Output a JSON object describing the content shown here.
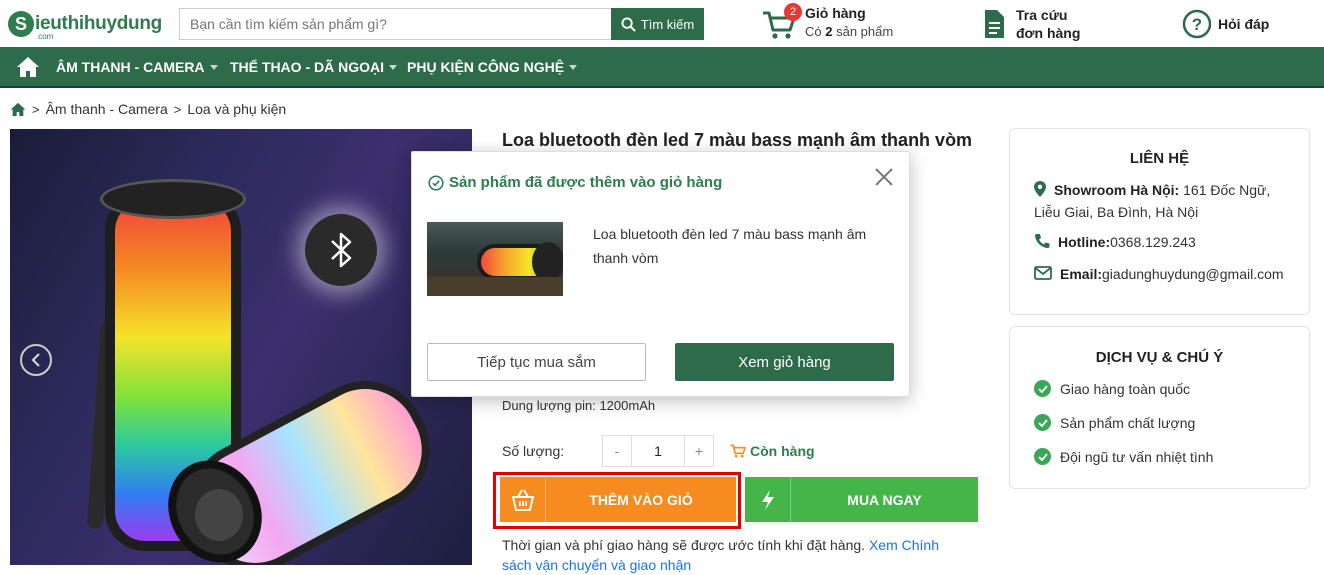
{
  "header": {
    "logo_text": "ieuthihuydung",
    "logo_initial": "S",
    "logo_domain": ".com",
    "search_placeholder": "Bạn cần tìm kiếm sản phẩm gì?",
    "search_button": "Tìm kiếm",
    "cart_title": "Giỏ hàng",
    "cart_count": "2",
    "cart_sub_prefix": "Có",
    "cart_sub_count": "2",
    "cart_sub_suffix": "sản phẩm",
    "track_line1": "Tra cứu",
    "track_line2": "đơn hàng",
    "help_label": "Hỏi đáp"
  },
  "nav": {
    "items": [
      {
        "label": "ÂM THANH - CAMERA"
      },
      {
        "label": "THỂ THAO - DÃ NGOẠI"
      },
      {
        "label": "PHỤ KIỆN CÔNG NGHỆ"
      }
    ]
  },
  "breadcrumb": [
    "Âm thanh - Camera",
    "Loa và phụ kiện"
  ],
  "product": {
    "title": "Loa bluetooth đèn led 7 màu bass mạnh âm thanh vòm",
    "battery": "Dung lượng pin: 1200mAh",
    "qty_label": "Số lượng:",
    "qty_minus": "-",
    "qty_value": "1",
    "qty_plus": "+",
    "stock": "Còn hàng",
    "add_to_cart": "THÊM VÀO GIỎ",
    "buy_now": "MUA NGAY",
    "ship_note": "Thời gian và phí giao hàng sẽ được ước tính khi đặt hàng.",
    "ship_link": "Xem Chính sách vận chuyển và giao nhận"
  },
  "contact": {
    "title": "LIÊN HỆ",
    "showroom_label": "Showroom Hà Nội:",
    "showroom_value": "161 Đốc Ngữ, Liễu Giai, Ba Đình, Hà Nội",
    "hotline_label": "Hotline:",
    "hotline_value": "0368.129.243",
    "email_label": "Email:",
    "email_value": "giadunghuydung@gmail.com"
  },
  "services": {
    "title": "DỊCH VỤ & CHÚ Ý",
    "items": [
      "Giao hàng toàn quốc",
      "Sản phẩm chất lượng",
      "Đội ngũ tư vấn nhiệt tình"
    ]
  },
  "modal": {
    "heading": "Sản phẩm đã được thêm vào giỏ hàng",
    "product_name": "Loa bluetooth đèn led 7 màu bass mạnh âm thanh vòm",
    "continue_button": "Tiếp tục mua sắm",
    "view_cart_button": "Xem giỏ hàng"
  },
  "colors": {
    "brand_green": "#2e6b4a",
    "accent_orange": "#f68b1f",
    "buy_green": "#44b649",
    "highlight_red": "#e30000",
    "badge_red": "#e53935"
  },
  "icons": {
    "search": "search-icon",
    "cart": "cart-icon",
    "track": "document-icon",
    "help": "question-icon",
    "home": "home-icon",
    "location": "location-pin-icon",
    "phone": "phone-icon",
    "email": "envelope-icon",
    "check": "check-circle-icon",
    "close": "close-icon",
    "basket": "basket-icon",
    "lightning": "lightning-icon",
    "bluetooth": "bluetooth-icon",
    "prev": "chevron-left-icon"
  }
}
